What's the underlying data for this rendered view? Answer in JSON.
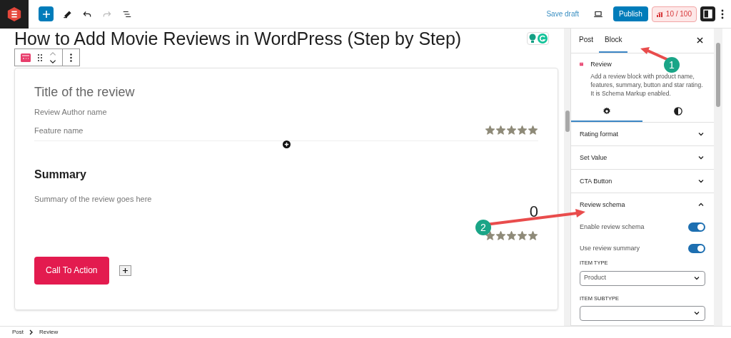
{
  "toolbar": {
    "save_draft": "Save draft",
    "publish": "Publish",
    "score": "10 / 100"
  },
  "post_title": "How to Add Movie Reviews in WordPress (Step by Step)",
  "review": {
    "title_placeholder": "Title of the review",
    "author_placeholder": "Review Author name",
    "features": [
      {
        "name": "Feature name",
        "stars": 5
      }
    ],
    "summary_heading": "Summary",
    "summary_placeholder": "Summary of the review goes here",
    "score": "0",
    "stars": 5,
    "cta": "Call To Action"
  },
  "sidebar": {
    "tabs": [
      {
        "label": "Post",
        "selected": false
      },
      {
        "label": "Block",
        "selected": true
      }
    ],
    "block": {
      "name": "Review",
      "description": "Add a review block with product name, features, summary, button and star rating. It is Schema Markup enabled."
    },
    "subtabs": [
      {
        "kind": "settings",
        "selected": true
      },
      {
        "kind": "styles",
        "selected": false
      }
    ],
    "panels": [
      {
        "title": "Rating format",
        "expanded": false
      },
      {
        "title": "Set Value",
        "expanded": false
      },
      {
        "title": "CTA Button",
        "expanded": false
      },
      {
        "title": "Review schema",
        "expanded": true,
        "toggles": [
          {
            "label": "Enable review schema",
            "on": true
          },
          {
            "label": "Use review summary",
            "on": true
          }
        ],
        "selects": [
          {
            "label": "ITEM TYPE",
            "value": "Product"
          },
          {
            "label": "ITEM SUBTYPE"
          }
        ]
      }
    ]
  },
  "breadcrumb": [
    "Post",
    "Review"
  ],
  "callouts": [
    "1",
    "2"
  ]
}
